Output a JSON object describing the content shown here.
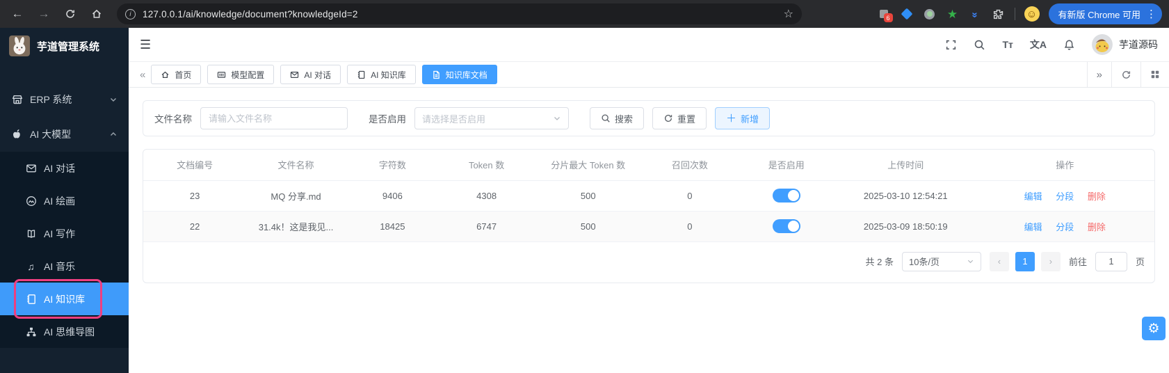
{
  "browser": {
    "url": "127.0.0.1/ai/knowledge/document?knowledgeId=2",
    "update_button": "有新版 Chrome 可用",
    "extension_badge": "6"
  },
  "icons": {
    "back": "←",
    "forward": "→",
    "star": "☆",
    "dots_vertical": "⋮",
    "hamburger": "☰",
    "music": "♫",
    "gear": "⚙",
    "plus": "＋",
    "chevron_left_double": "«",
    "chevron_right_double": "»",
    "page_prev": "‹",
    "page_next": "›",
    "font_size": "Tт",
    "translate": "文A",
    "info": "i",
    "face": "☺",
    "green_star": "★",
    "double_chevron": "»"
  },
  "sidebar": {
    "logo_title": "芋道管理系统",
    "top_items": [
      {
        "label": "ERP 系统",
        "icon": "shop-icon"
      },
      {
        "label": "AI 大模型",
        "icon": "apple-icon"
      }
    ],
    "sub_items": [
      {
        "label": "AI 对话",
        "icon": "envelope-icon"
      },
      {
        "label": "AI 绘画",
        "icon": "image-icon"
      },
      {
        "label": "AI 写作",
        "icon": "writing-icon"
      },
      {
        "label": "AI 音乐",
        "icon": "music-icon"
      },
      {
        "label": "AI 知识库",
        "icon": "notebook-icon",
        "active": true
      },
      {
        "label": "AI 思维导图",
        "icon": "sitemap-icon"
      }
    ]
  },
  "header": {
    "username": "芋道源码"
  },
  "tabbar": {
    "tabs": [
      {
        "label": "首页",
        "icon": "home-icon"
      },
      {
        "label": "模型配置",
        "icon": "config-icon"
      },
      {
        "label": "AI 对话",
        "icon": "envelope-icon"
      },
      {
        "label": "AI 知识库",
        "icon": "notebook-icon"
      },
      {
        "label": "知识库文档",
        "icon": "document-icon",
        "active": true
      }
    ]
  },
  "filter": {
    "name_label": "文件名称",
    "name_placeholder": "请输入文件名称",
    "enabled_label": "是否启用",
    "enabled_placeholder": "请选择是否启用",
    "search_label": "搜索",
    "reset_label": "重置",
    "add_label": "新增"
  },
  "table": {
    "columns": [
      "文档编号",
      "文件名称",
      "字符数",
      "Token 数",
      "分片最大 Token 数",
      "召回次数",
      "是否启用",
      "上传时间",
      "操作"
    ],
    "rows": [
      {
        "doc_id": "23",
        "file_name": "MQ 分享.md",
        "char_count": "9406",
        "token_count": "4308",
        "max_token": "500",
        "recall_count": "0",
        "enabled": true,
        "upload_time": "2025-03-10 12:54:21"
      },
      {
        "doc_id": "22",
        "file_name": "31.4k！这是我见...",
        "char_count": "18425",
        "token_count": "6747",
        "max_token": "500",
        "recall_count": "0",
        "enabled": true,
        "upload_time": "2025-03-09 18:50:19"
      }
    ],
    "row_actions": [
      "编辑",
      "分段",
      "删除"
    ]
  },
  "pagination": {
    "total_text": "共 2 条",
    "page_size": "10条/页",
    "current_page": "1",
    "goto_label": "前往",
    "goto_value": "1",
    "unit_label": "页"
  },
  "colors": {
    "accent": "#409eff",
    "danger": "#f56c6c",
    "highlight_ring": "#ee3f80",
    "sidebar_bg": "#14212f",
    "chrome_update_pill": "#2b72dd"
  }
}
